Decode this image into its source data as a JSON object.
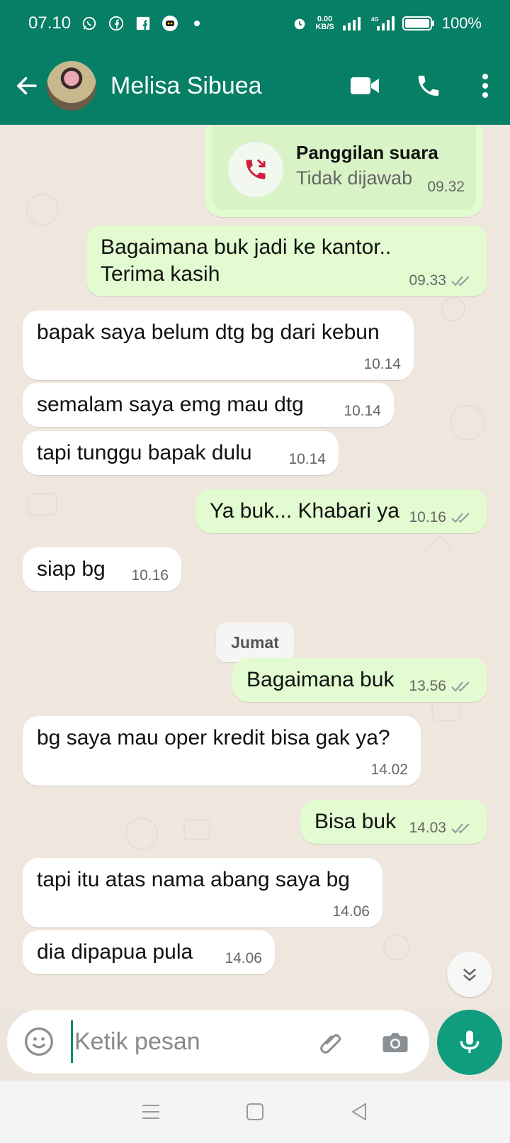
{
  "status": {
    "time": "07.10",
    "net_speed_top": "0.00",
    "net_speed_bottom": "KB/S",
    "battery": "100%",
    "network": "4G",
    "icons": [
      "whatsapp-icon",
      "facebook-icon",
      "facebook-square-icon",
      "app-icon",
      "dot-icon",
      "alarm-icon",
      "signal-icon",
      "battery-icon"
    ]
  },
  "header": {
    "contact_name": "Melisa Sibuea",
    "icons": [
      "back-arrow-icon",
      "video-call-icon",
      "voice-call-icon",
      "more-vert-icon"
    ]
  },
  "call_log": {
    "title": "Panggilan suara",
    "subtitle": "Tidak dijawab",
    "time": "09.32",
    "icon": "missed-call-icon",
    "color": "#d11f3f"
  },
  "messages": [
    {
      "direction": "out",
      "text": "Bagaimana buk jadi ke kantor..\nTerima kasih",
      "time": "09.33",
      "status": "read"
    },
    {
      "direction": "in",
      "text": "bapak saya belum dtg bg dari kebun",
      "time": "10.14"
    },
    {
      "direction": "in",
      "text": "semalam saya emg mau dtg",
      "time": "10.14"
    },
    {
      "direction": "in",
      "text": "tapi tunggu bapak dulu",
      "time": "10.14"
    },
    {
      "direction": "out",
      "text": "Ya buk... Khabari ya",
      "time": "10.16",
      "status": "read"
    },
    {
      "direction": "in",
      "text": "siap bg",
      "time": "10.16"
    },
    {
      "direction": "out",
      "text": "Bagaimana buk",
      "time": "13.56",
      "status": "read"
    },
    {
      "direction": "in",
      "text": "bg saya mau oper kredit bisa gak ya?",
      "time": "14.02"
    },
    {
      "direction": "out",
      "text": "Bisa buk",
      "time": "14.03",
      "status": "read"
    },
    {
      "direction": "in",
      "text": "tapi itu atas nama abang saya bg",
      "time": "14.06"
    },
    {
      "direction": "in",
      "text": "dia dipapua pula",
      "time": "14.06"
    }
  ],
  "date_separator": "Jumat",
  "composer": {
    "placeholder": "Ketik pesan",
    "icons": [
      "emoji-icon",
      "paperclip-icon",
      "camera-icon",
      "mic-icon"
    ]
  },
  "colors": {
    "primary": "#077e66",
    "outgoing_bubble": "#e2fbd0",
    "incoming_bubble": "#ffffff",
    "chat_bg": "#efe7de",
    "mic": "#0f9d7e"
  }
}
